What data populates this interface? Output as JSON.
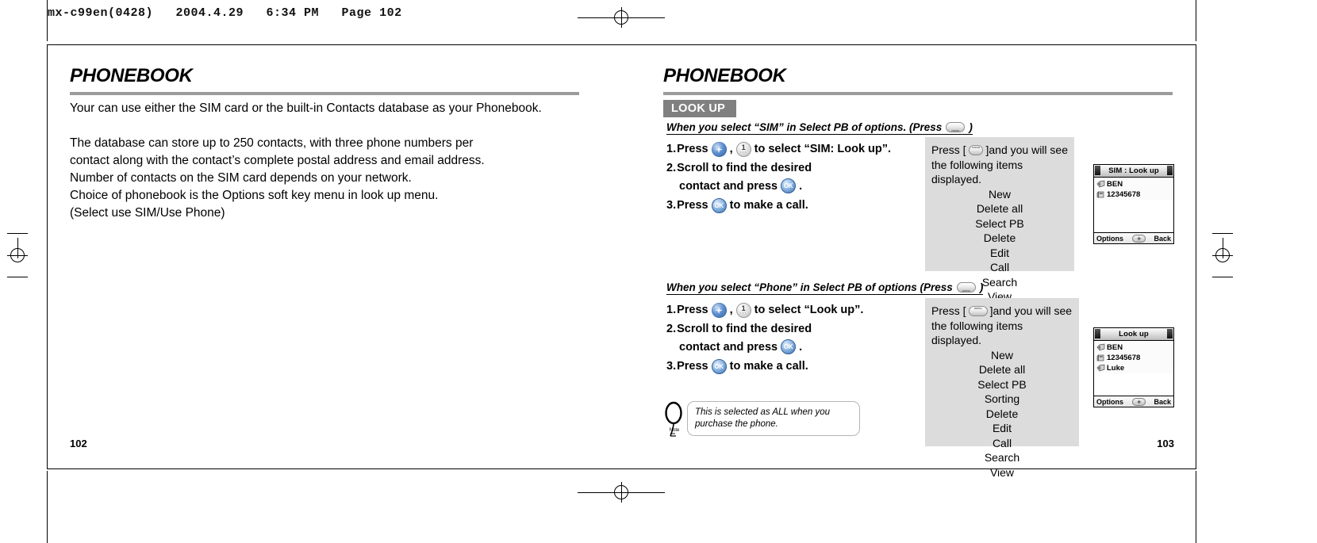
{
  "printer_header": "mx-c99en(0428)   2004.4.29   6:34 PM   Page 102",
  "left_page": {
    "chapter_title": "PHONEBOOK",
    "paragraphs": [
      "Your can use either the SIM card or the built-in Contacts database as your Phonebook.",
      "The database can store up to 250 contacts, with three phone numbers per",
      "contact along with the contact’s complete postal address and email address.",
      "Number of contacts on the SIM card depends on your network.",
      "Choice of phonebook is the Options soft key menu in look up menu.",
      "(Select use SIM/Use Phone)"
    ],
    "page_number": "102"
  },
  "right_page": {
    "chapter_title": "PHONEBOOK",
    "section_tag": "LOOK UP",
    "page_number": "103",
    "sections": [
      {
        "subhead_before": "When you select “SIM” in Select PB of options. (Press",
        "subhead_after": ")",
        "steps": [
          {
            "number": "1.",
            "before": "Press",
            "middle": ",",
            "after": "to select “SIM: Look up”.",
            "icons": [
              "nav-key-icon",
              "one-key-icon"
            ]
          },
          {
            "number": "2.",
            "line1": "Scroll to find the desired",
            "line2_before": "contact and press",
            "line2_after": ".",
            "icons": [
              "ok-key-icon"
            ]
          },
          {
            "number": "3.",
            "before": "Press",
            "after": "to make a call.",
            "icons": [
              "ok-key-icon"
            ]
          }
        ],
        "info_panel": {
          "lead_before": "Press [",
          "lead_after": "]and you will see",
          "lead_line2": "the following items displayed.",
          "items": [
            "New",
            "Delete all",
            "Select PB",
            "Delete",
            "Edit",
            "Call",
            "Search",
            "View"
          ]
        },
        "phone": {
          "title": "SIM : Look up",
          "rows": [
            {
              "icon": "contact-icon",
              "label": "BEN"
            },
            {
              "icon": "number-icon",
              "label": "12345678"
            }
          ],
          "softkey_left": "Options",
          "softkey_right": "Back"
        }
      },
      {
        "subhead_before": "When you select “Phone” in Select PB of options (Press",
        "subhead_after": ")",
        "steps": [
          {
            "number": "1.",
            "before": "Press",
            "middle": ",",
            "after": "to select “Look up”.",
            "icons": [
              "nav-key-icon",
              "one-key-icon"
            ]
          },
          {
            "number": "2.",
            "line1": "Scroll to find the desired",
            "line2_before": "contact and press",
            "line2_after": ".",
            "icons": [
              "ok-key-icon"
            ]
          },
          {
            "number": "3.",
            "before": "Press",
            "after": "to make a call.",
            "icons": [
              "ok-key-icon"
            ]
          }
        ],
        "info_panel": {
          "lead_before": "Press [",
          "lead_after": "]and you will see",
          "lead_line2": "the following items displayed.",
          "items": [
            "New",
            "Delete all",
            "Select PB",
            "Sorting",
            "Delete",
            "Edit",
            "Call",
            "Search",
            "View"
          ]
        },
        "phone": {
          "title": "Look up",
          "rows": [
            {
              "icon": "contact-icon",
              "label": "BEN"
            },
            {
              "icon": "number-icon",
              "label": "12345678"
            },
            {
              "icon": "contact-icon",
              "label": "Luke"
            }
          ],
          "softkey_left": "Options",
          "softkey_right": "Back"
        }
      }
    ],
    "note": {
      "label": "Note",
      "text": "This is selected as ALL when you purchase the phone."
    }
  },
  "colors": {
    "section_tag_bg": "#808080",
    "rule": "#9b9b9b",
    "panel_bg": "#dcdcdc"
  }
}
